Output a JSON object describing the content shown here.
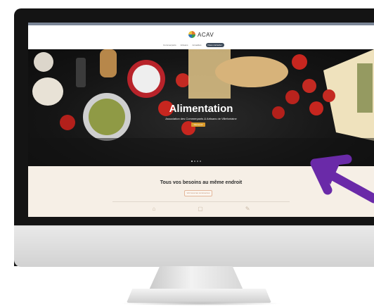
{
  "logo": {
    "text": "ACAV"
  },
  "nav": {
    "items": [
      "Commerçants",
      "Artisans",
      "Actualités",
      "Nous contacter"
    ]
  },
  "hero": {
    "title": "Alimentation",
    "subtitle": "Association des Commerçants & Artisans de Villefontaine",
    "button": "Découvrir"
  },
  "section": {
    "title": "Tous vos besoins au même endroit",
    "button": "Voir tous les commerces"
  },
  "colors": {
    "accent": "#d99a2b",
    "arrow": "#6a2aa8",
    "nav_active": "#3d4a5a"
  }
}
